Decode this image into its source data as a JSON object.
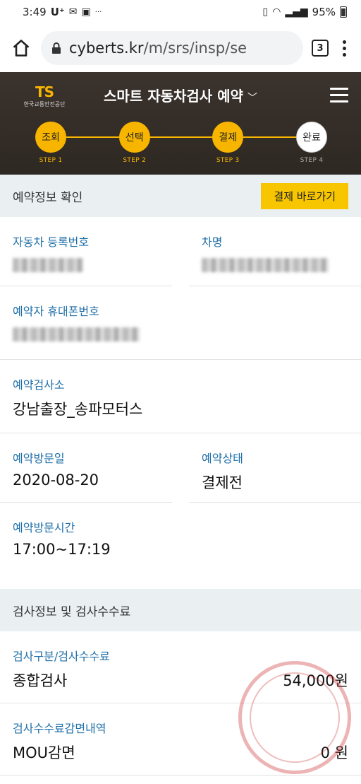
{
  "status_bar": {
    "time": "3:49",
    "carrier": "U⁺",
    "battery": "95%"
  },
  "browser": {
    "url_host": "cyberts.kr",
    "url_path": "/m/srs/insp/se",
    "tab_count": "3"
  },
  "header": {
    "logo_text": "TS",
    "logo_sub": "한국교통안전공단",
    "title": "스마트 자동차검사 예약",
    "steps": [
      {
        "label": "조회",
        "sub": "STEP 1"
      },
      {
        "label": "선택",
        "sub": "STEP 2"
      },
      {
        "label": "결제",
        "sub": "STEP 3"
      },
      {
        "label": "완료",
        "sub": "STEP 4"
      }
    ]
  },
  "reservation": {
    "section_title": "예약정보 확인",
    "pay_button": "결제 바로가기",
    "car_number_label": "자동차 등록번호",
    "car_name_label": "차명",
    "phone_label": "예약자 휴대폰번호",
    "center_label": "예약검사소",
    "center_value": "강남출장_송파모터스",
    "date_label": "예약방문일",
    "date_value": "2020-08-20",
    "status_label": "예약상태",
    "status_value": "결제전",
    "time_label": "예약방문시간",
    "time_value": "17:00~17:19"
  },
  "inspection": {
    "section_title": "검사정보 및 검사수수료",
    "type_label": "검사구분/검사수수료",
    "type_value": "종합검사",
    "fee_value": "54,000원",
    "discount_label": "검사수수료감면내역",
    "discount_value": "MOU감면",
    "discount_amount": "0 원"
  },
  "colors": {
    "accent_yellow": "#f7b500",
    "label_blue": "#1f6fa8",
    "header_bg": "#3a322c",
    "section_bg": "#eaeff2"
  }
}
